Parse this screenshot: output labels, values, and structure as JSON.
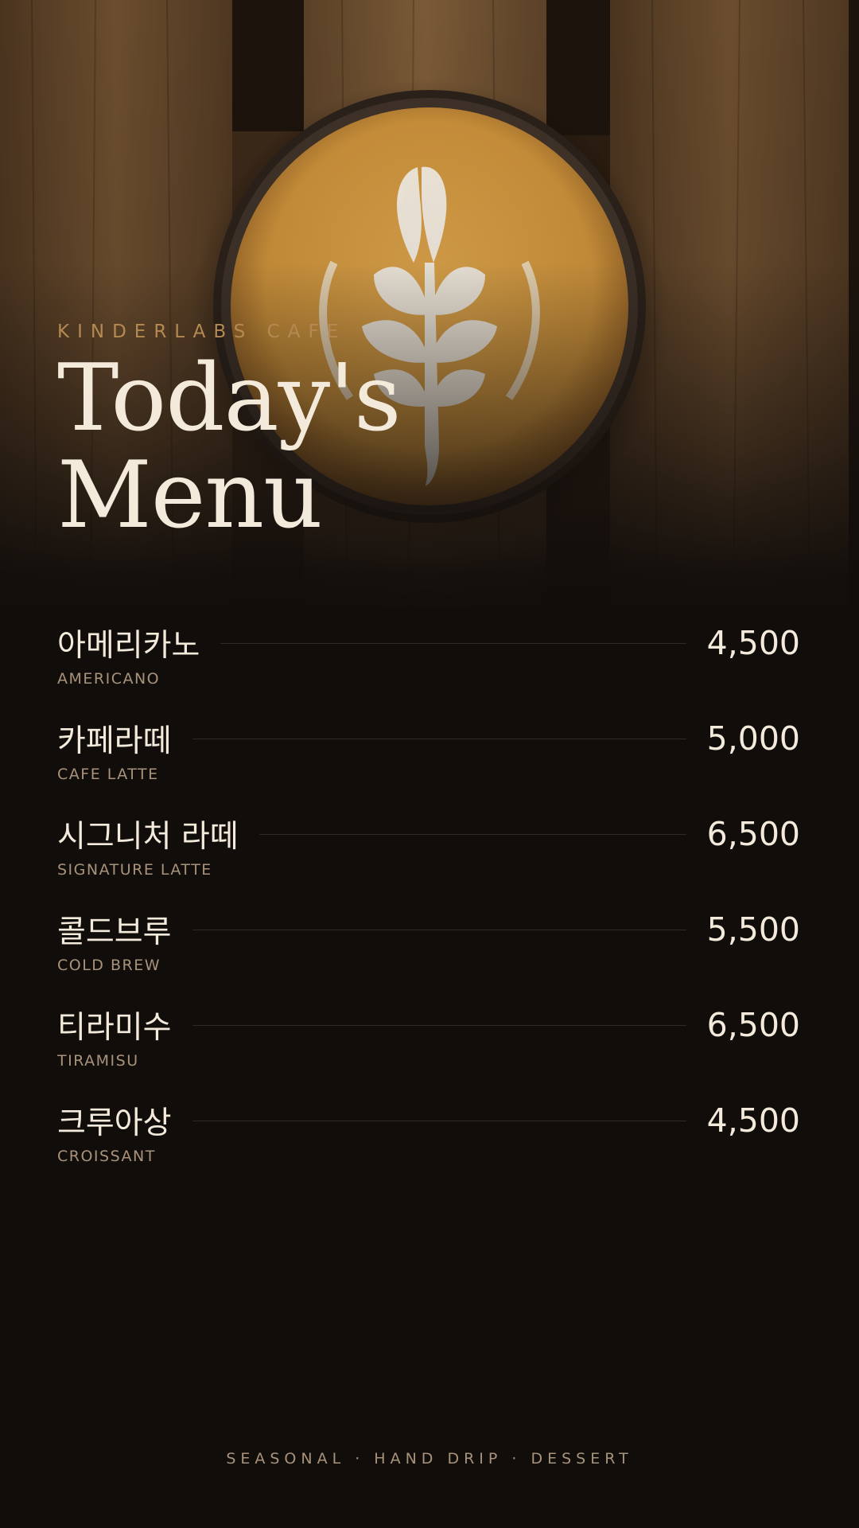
{
  "header": {
    "brand": "KINDERLABS CAFE",
    "title_line1": "Today's",
    "title_line2": "Menu"
  },
  "menu": {
    "items": [
      {
        "name_kr": "아메리카노",
        "name_en": "AMERICANO",
        "price": "4,500"
      },
      {
        "name_kr": "카페라떼",
        "name_en": "CAFE LATTE",
        "price": "5,000"
      },
      {
        "name_kr": "시그니처 라떼",
        "name_en": "SIGNATURE LATTE",
        "price": "6,500"
      },
      {
        "name_kr": "콜드브루",
        "name_en": "COLD BREW",
        "price": "5,500"
      },
      {
        "name_kr": "티라미수",
        "name_en": "TIRAMISU",
        "price": "6,500"
      },
      {
        "name_kr": "크루아상",
        "name_en": "CROISSANT",
        "price": "4,500"
      }
    ]
  },
  "footer": {
    "tagline": "SEASONAL · HAND DRIP · DESSERT"
  },
  "colors": {
    "background": "#110d0b",
    "accent": "#b48a52",
    "text": "#f3eadb",
    "subtext": "#a8937a"
  },
  "hero_image": {
    "icon": "latte-art-photo"
  }
}
